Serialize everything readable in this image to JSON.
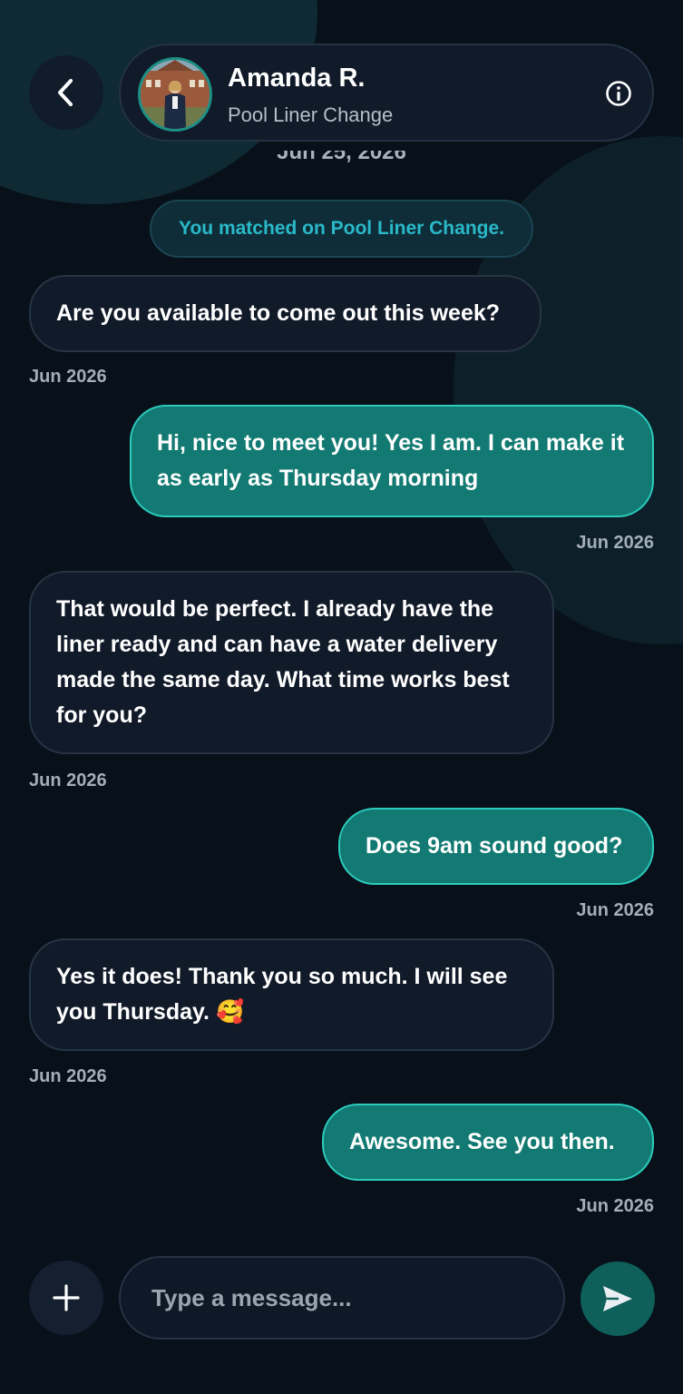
{
  "header": {
    "contact_name": "Amanda R.",
    "contact_subtitle": "Pool Liner Change",
    "icons": {
      "back": "chevron-left-icon",
      "info": "info-circle-icon"
    },
    "partial_date": "Jun 25, 2026"
  },
  "system_message": "You matched on Pool Liner Change.",
  "messages": [
    {
      "direction": "in",
      "text": "Are you available to come out this week?",
      "time": "Jun 2026"
    },
    {
      "direction": "out",
      "text": "Hi, nice to meet you! Yes I am. I can make it as early as Thursday morning",
      "time": "Jun 2026"
    },
    {
      "direction": "in",
      "text": "That would be perfect. I already have the liner ready and can have a water delivery made the same day. What time works best for you?",
      "time": "Jun 2026"
    },
    {
      "direction": "out",
      "text": "Does 9am sound good?",
      "time": "Jun 2026"
    },
    {
      "direction": "in",
      "text": "Yes it does! Thank you so much. I will see you Thursday.",
      "emoji": "🥰",
      "time": "Jun 2026"
    },
    {
      "direction": "out",
      "text": "Awesome. See you then.",
      "time": "Jun 2026"
    }
  ],
  "composer": {
    "placeholder": "Type a message...",
    "icons": {
      "attach": "plus-icon",
      "send": "send-icon"
    }
  },
  "colors": {
    "background": "#08101a",
    "incoming_bubble": "#111a29",
    "outgoing_bubble": "#127a72",
    "outgoing_border": "#2ccbbd",
    "accent_text": "#29b9c9"
  }
}
